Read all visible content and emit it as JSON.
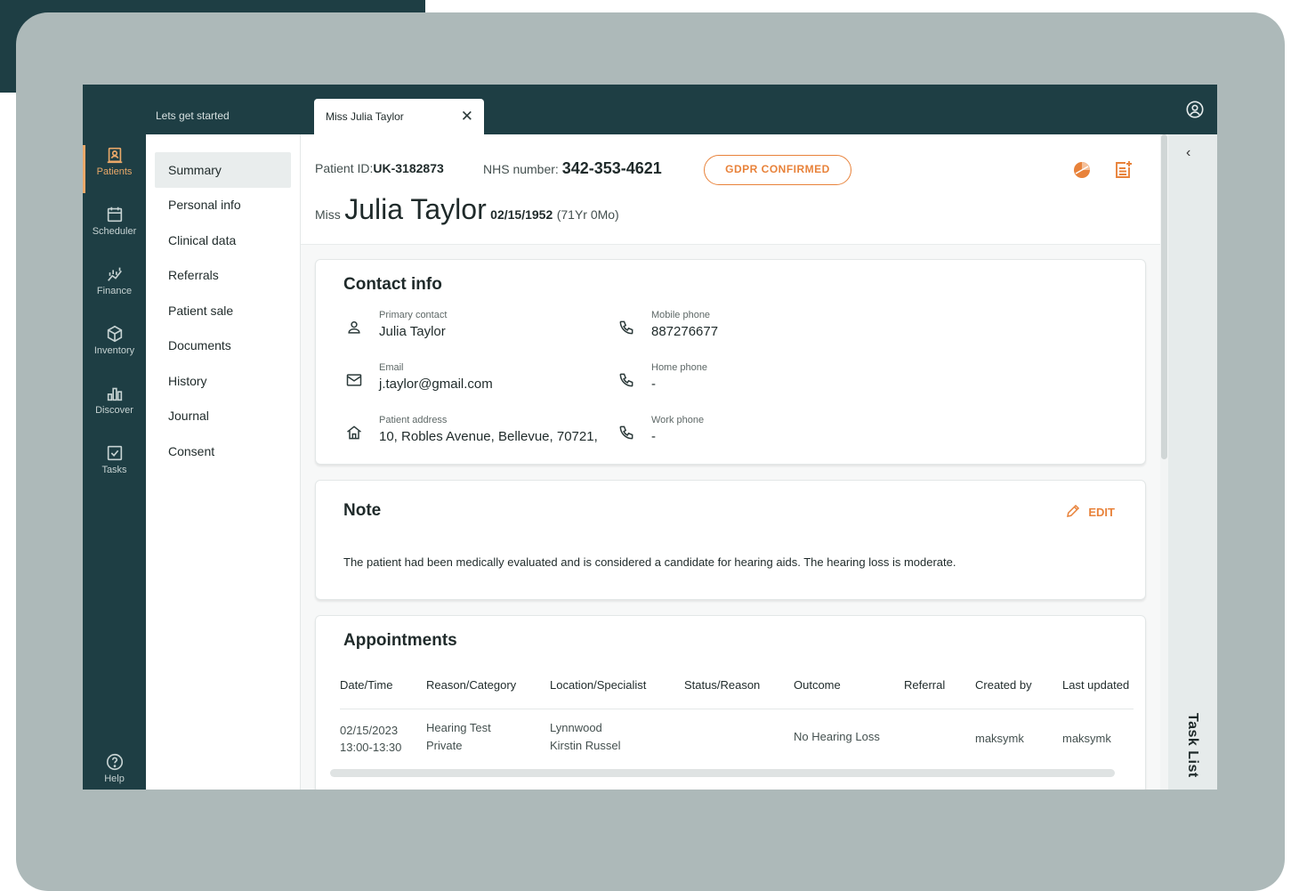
{
  "topbar": {
    "home_tab": "Lets get started",
    "patient_tab": "Miss Julia Taylor",
    "close_glyph": "✕"
  },
  "rail": [
    {
      "label": "Patients",
      "icon": "patients-icon",
      "active": true
    },
    {
      "label": "Scheduler",
      "icon": "calendar-icon",
      "active": false
    },
    {
      "label": "Finance",
      "icon": "finance-icon",
      "active": false
    },
    {
      "label": "Inventory",
      "icon": "box-icon",
      "active": false
    },
    {
      "label": "Discover",
      "icon": "bar-chart-icon",
      "active": false
    },
    {
      "label": "Tasks",
      "icon": "checkbox-icon",
      "active": false
    }
  ],
  "help_label": "Help",
  "subnav": [
    "Summary",
    "Personal info",
    "Clinical data",
    "Referrals",
    "Patient sale",
    "Documents",
    "History",
    "Journal",
    "Consent"
  ],
  "header": {
    "patient_id_label": "Patient ID:",
    "patient_id": "UK-3182873",
    "nhs_label": "NHS number:",
    "nhs_number": "342-353-4621",
    "gdpr": "GDPR CONFIRMED",
    "title": "Miss",
    "name": "Julia Taylor",
    "dob": "02/15/1952",
    "age": "(71Yr 0Mo)"
  },
  "contact": {
    "title": "Contact info",
    "primary_label": "Primary contact",
    "primary_value": "Julia Taylor",
    "email_label": "Email",
    "email_value": "j.taylor@gmail.com",
    "address_label": "Patient address",
    "address_value": "10, Robles Avenue, Bellevue, 70721,",
    "mobile_label": "Mobile phone",
    "mobile_value": "887276677",
    "home_label": "Home phone",
    "home_value": "-",
    "work_label": "Work phone",
    "work_value": "-"
  },
  "note": {
    "title": "Note",
    "edit_label": "EDIT",
    "text": "The patient had been medically evaluated and is considered a candidate for hearing aids. The hearing loss is moderate."
  },
  "appointments": {
    "title": "Appointments",
    "columns": [
      "Date/Time",
      "Reason/Category",
      "Location/Specialist",
      "Status/Reason",
      "Outcome",
      "Referral",
      "Created by",
      "Last updated"
    ],
    "row": {
      "date": "02/15/2023",
      "time": "13:00-13:30",
      "reason": "Hearing Test",
      "category": "Private",
      "location": "Lynnwood",
      "specialist": "Kirstin Russel",
      "outcome": "No Hearing Loss",
      "created_by": "maksymk",
      "last_updated": "maksymk"
    }
  },
  "taskpanel": {
    "label": "Task List",
    "chevron": "‹"
  },
  "colors": {
    "brand_dark": "#1e3e44",
    "accent": "#e8823a",
    "frame": "#adb9b9"
  }
}
